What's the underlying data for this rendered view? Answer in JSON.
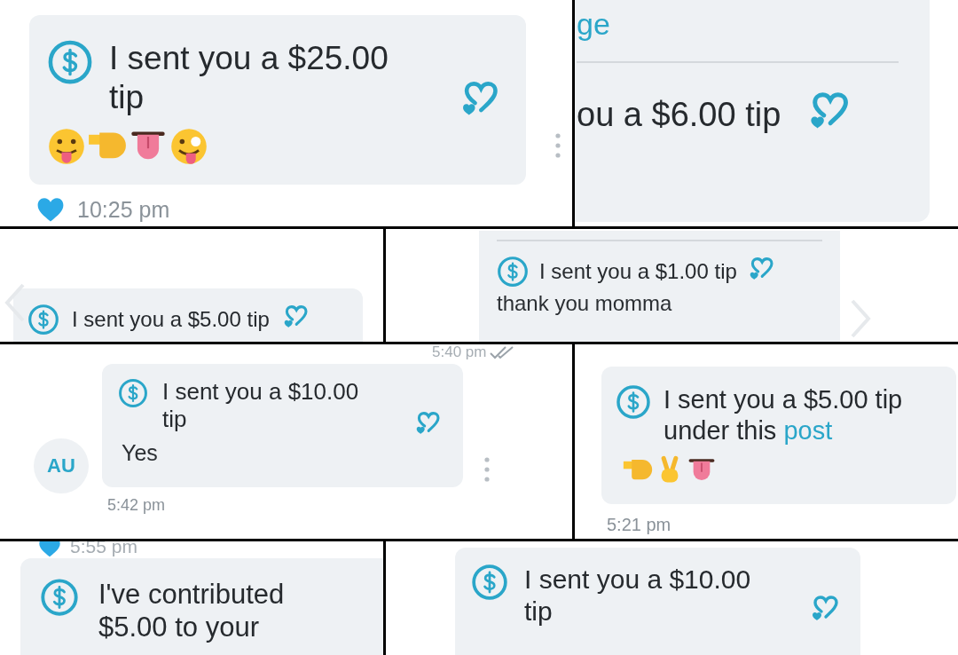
{
  "panels": [
    {
      "kind": "tip",
      "message": "I sent you a $25.00 tip",
      "emojis": [
        {
          "kind": "tongue-face"
        },
        {
          "kind": "pointing-hand"
        },
        {
          "kind": "tongue"
        },
        {
          "kind": "zany-face"
        }
      ],
      "time": "10:25 pm",
      "liked": true
    },
    {
      "kind": "cut_tip",
      "header": "ge",
      "message": "ou a $6.00 tip"
    },
    {
      "kind": "tip",
      "message": "I sent you a $5.00 tip"
    },
    {
      "kind": "tip",
      "message": "I sent you a $1.00 tip",
      "note": "thank you momma"
    },
    {
      "kind": "tip",
      "top_time": "5:40 pm",
      "read": true,
      "avatar": "AU",
      "message": "I sent you a $10.00 tip",
      "note": "Yes",
      "time": "5:42 pm"
    },
    {
      "kind": "tip",
      "message": "I sent you a $5.00 tip under this",
      "link": "post",
      "emojis": [
        {
          "kind": "pointing-hand"
        },
        {
          "kind": "peace-hand"
        },
        {
          "kind": "tongue"
        }
      ],
      "time": "5:21 pm"
    },
    {
      "kind": "tip",
      "top_time": "5:55 pm",
      "liked": true,
      "message": "I've contributed $5.00 to your"
    },
    {
      "kind": "tip",
      "message": "I sent you a $10.00 tip"
    }
  ]
}
